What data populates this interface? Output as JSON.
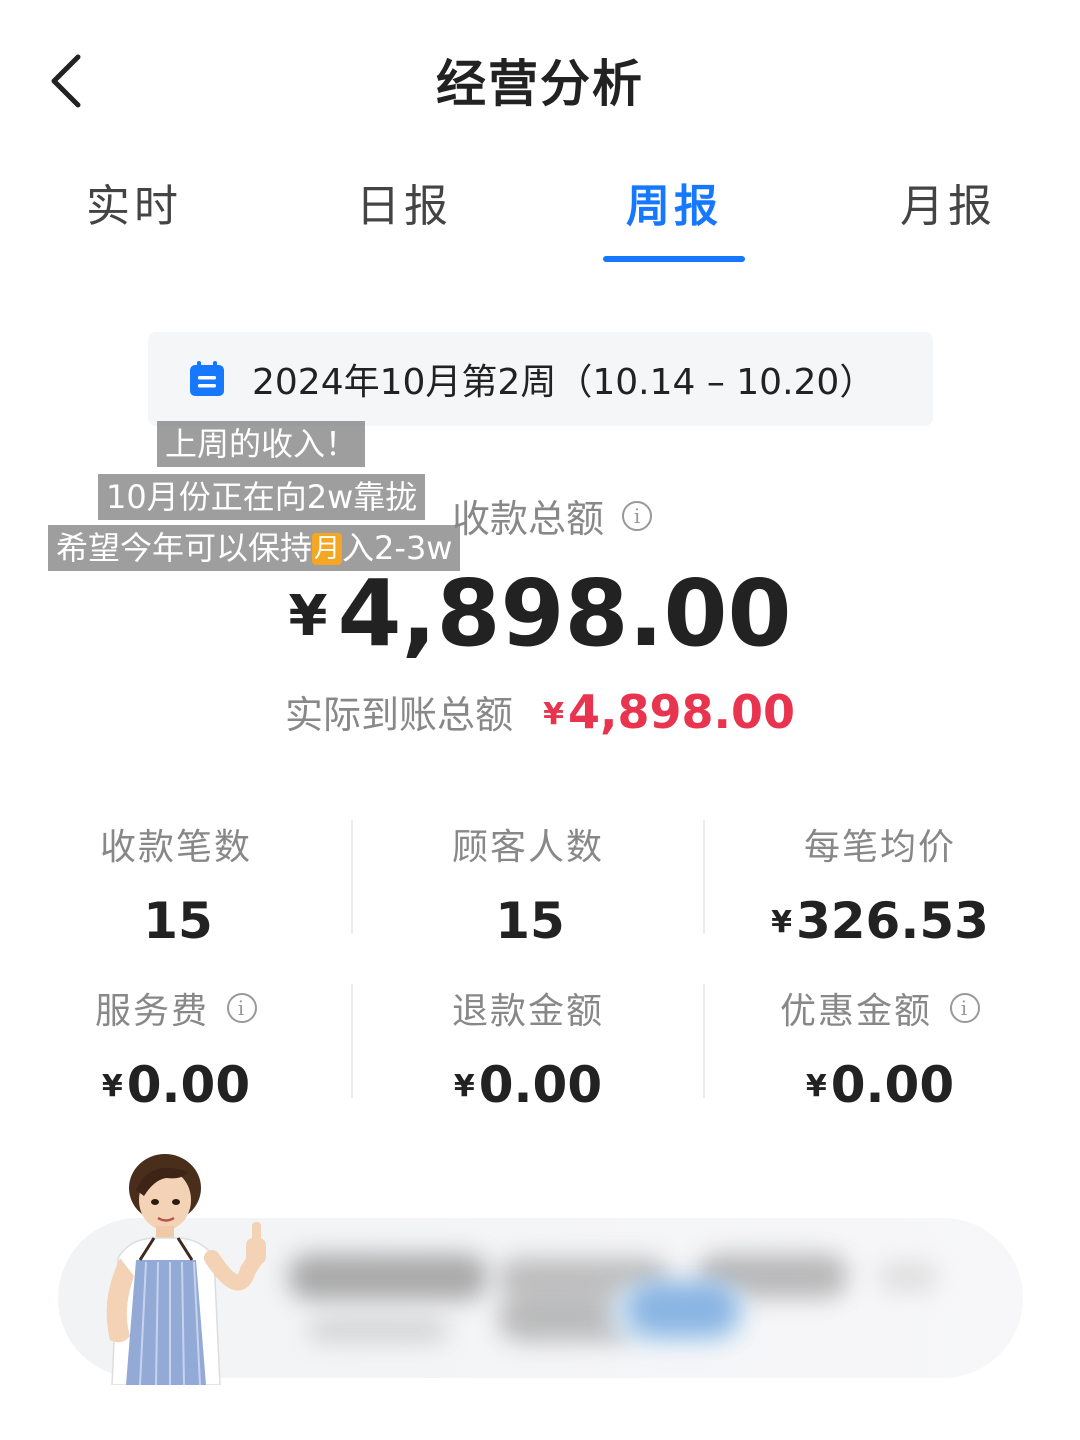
{
  "header": {
    "back_icon": "chevron-left-icon",
    "title": "经营分析"
  },
  "tabs": [
    {
      "label": "实时",
      "active": false
    },
    {
      "label": "日报",
      "active": false
    },
    {
      "label": "周报",
      "active": true
    },
    {
      "label": "月报",
      "active": false
    }
  ],
  "date_range": {
    "icon": "calendar-icon",
    "text": "2024年10月第2周（10.14 – 10.20）"
  },
  "captions": {
    "line1": "上周的收入！",
    "line2": "10月份正在向2w靠拢",
    "line3_pre": "希望今年可以保持",
    "line3_emoji": "月",
    "line3_post": "入2-3w"
  },
  "totals": {
    "label": "收款总额",
    "currency": "¥",
    "amount": "4,898.00",
    "actual_label": "实际到账总额",
    "actual_currency": "¥",
    "actual_amount": "4,898.00"
  },
  "stats": [
    {
      "label": "收款笔数",
      "value": "15",
      "currency": "",
      "info": false
    },
    {
      "label": "顾客人数",
      "value": "15",
      "currency": "",
      "info": false
    },
    {
      "label": "每笔均价",
      "value": "326.53",
      "currency": "¥",
      "info": false
    },
    {
      "label": "服务费",
      "value": "0.00",
      "currency": "¥",
      "info": true
    },
    {
      "label": "退款金额",
      "value": "0.00",
      "currency": "¥",
      "info": false
    },
    {
      "label": "优惠金额",
      "value": "0.00",
      "currency": "¥",
      "info": true
    }
  ],
  "colors": {
    "accent": "#1677ff",
    "amount_red": "#e8344e",
    "label_gray": "#888888"
  }
}
